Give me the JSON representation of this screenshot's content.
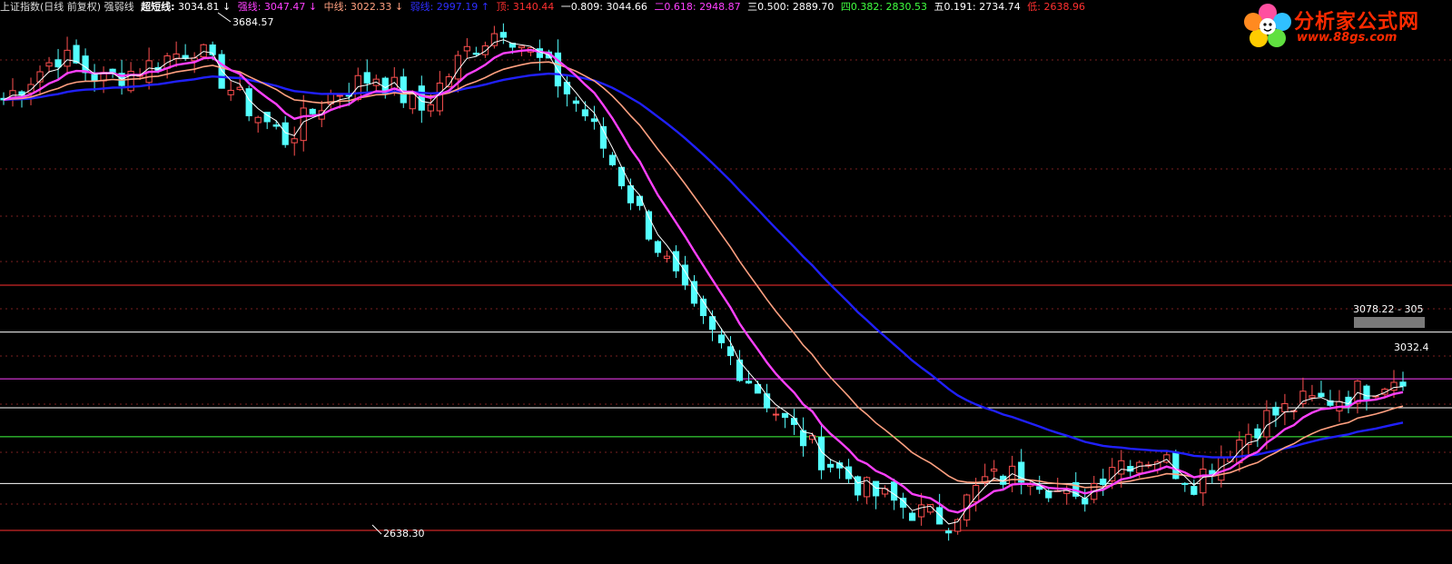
{
  "legend": {
    "title": "上证指数(日线 前复权) 强弱线",
    "super_label": "超短线:",
    "super_value": "3034.81",
    "strong_label": "强线:",
    "strong_value": "3047.47",
    "mid_label": "中线:",
    "mid_value": "3022.33",
    "weak_label": "弱线:",
    "weak_value": "2997.19",
    "top_label": "顶:",
    "top_value": "3140.44",
    "f1_label": "一0.809:",
    "f1_value": "3044.66",
    "f2_label": "二0.618:",
    "f2_value": "2948.87",
    "f3_label": "三0.500:",
    "f3_value": "2889.70",
    "f4_label": "四0.382:",
    "f4_value": "2830.53",
    "f5_label": "五0.191:",
    "f5_value": "2734.74",
    "low_label": "低:",
    "low_value": "2638.96",
    "arrow_down": "↓",
    "arrow_up": "↑"
  },
  "watermark": {
    "name": "分析家公式网",
    "url": "www.88gs.com"
  },
  "colors": {
    "up": "#ff5050",
    "down": "#54ffff",
    "super": "#ffffff",
    "strong": "#ff40ff",
    "mid": "#ffa080",
    "weak": "#2020ff",
    "top": "#ff3030",
    "fib1": "#ffffff",
    "fib2": "#ff40ff",
    "fib3": "#ffffff",
    "fib4": "#40ff40",
    "fib5": "#ffffff",
    "low": "#ff3030",
    "dots": "#7a2020"
  },
  "chart_data": {
    "type": "candlestick",
    "series_names": [
      "超短线",
      "强线",
      "中线",
      "弱线"
    ],
    "levels": [
      {
        "name": "顶",
        "value": 3140.44,
        "color_key": "top"
      },
      {
        "name": "一0.809",
        "value": 3044.66,
        "color_key": "fib1"
      },
      {
        "name": "二0.618",
        "value": 2948.87,
        "color_key": "fib2"
      },
      {
        "name": "三0.500",
        "value": 2889.7,
        "color_key": "fib3"
      },
      {
        "name": "四0.382",
        "value": 2830.53,
        "color_key": "fib4"
      },
      {
        "name": "五0.191",
        "value": 2734.74,
        "color_key": "fib5"
      },
      {
        "name": "低",
        "value": 2638.96,
        "color_key": "low"
      }
    ],
    "annotations": [
      {
        "text": "3684.57",
        "kind": "high"
      },
      {
        "text": "2638.30",
        "kind": "low"
      },
      {
        "text": "3078.22 - 305",
        "kind": "cursor"
      },
      {
        "text": "3032.4",
        "kind": "right"
      }
    ],
    "candles": [],
    "super_line": [],
    "strong_line": [],
    "mid_line": [],
    "weak_line": [],
    "ylim": [
      2625,
      3720
    ]
  }
}
